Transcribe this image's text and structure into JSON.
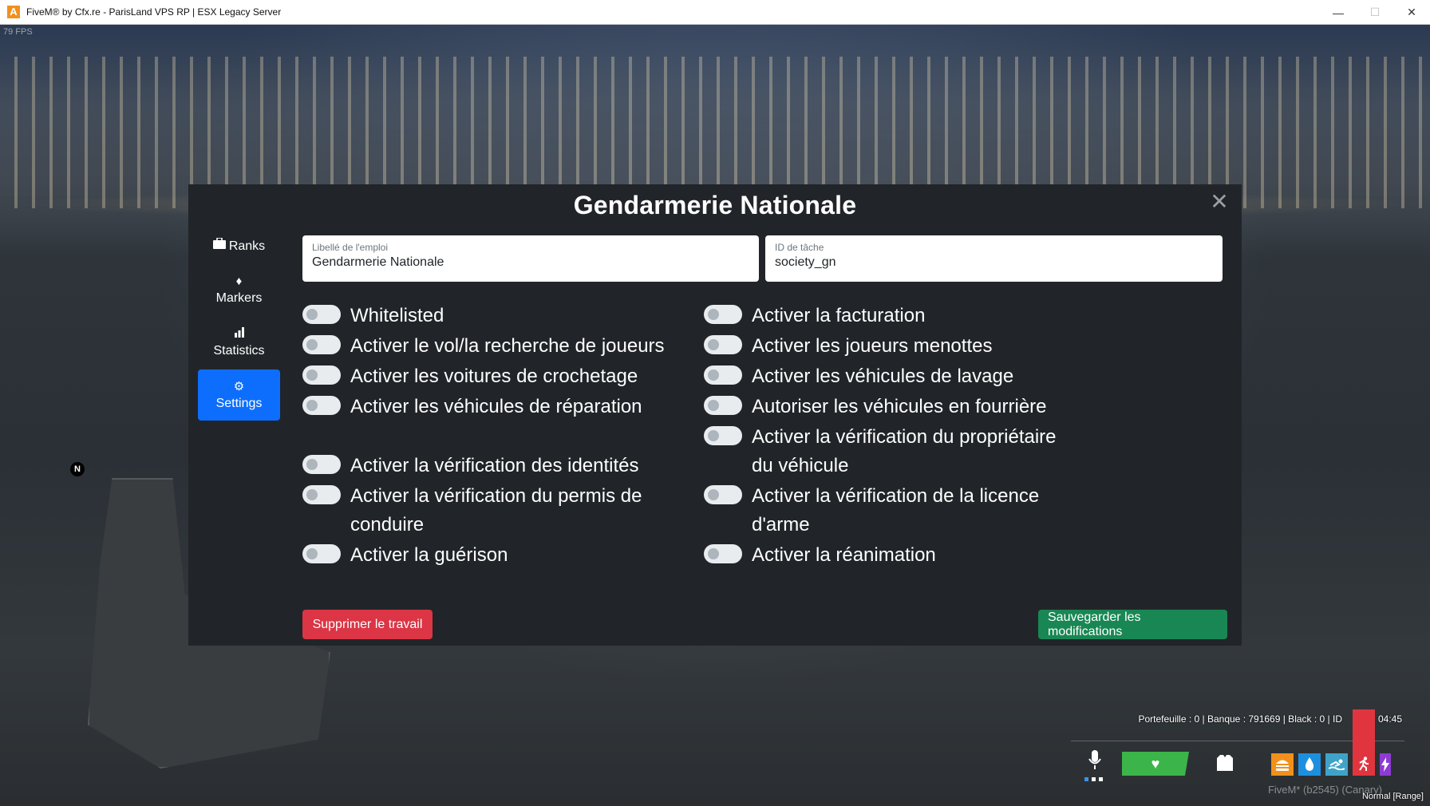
{
  "window": {
    "title": "FiveM® by Cfx.re - ParisLand VPS RP | ESX Legacy Server",
    "icon_letter": "A",
    "controls": {
      "minimize": "—",
      "restore": "☐",
      "close": "✕"
    }
  },
  "overlay": {
    "fps": "79 FPS"
  },
  "modal": {
    "title": "Gendarmerie Nationale",
    "close_symbol": "✕",
    "nav": [
      {
        "label": "Ranks",
        "icon": "briefcase-icon",
        "glyph": "💼"
      },
      {
        "label": "Markers",
        "icon": "map-marker-icon",
        "glyph": "♦"
      },
      {
        "label": "Statistics",
        "icon": "bar-chart-icon",
        "glyph": "▟"
      },
      {
        "label": "Settings",
        "icon": "gear-icon",
        "glyph": "⚙",
        "active": true
      }
    ],
    "fields": {
      "job_label": {
        "label": "Libellé de l'emploi",
        "value": "Gendarmerie Nationale"
      },
      "job_id": {
        "label": "ID de tâche",
        "value": "society_gn"
      }
    },
    "toggles_left": [
      {
        "label": "Whitelisted",
        "checked": false
      },
      {
        "label": "Activer le vol/la recherche de joueurs",
        "checked": false
      },
      {
        "label": "Activer les voitures de crochetage",
        "checked": false
      },
      {
        "label": "Activer les véhicules de réparation",
        "checked": false
      },
      {
        "label": "Activer la vérification des identités",
        "checked": false
      },
      {
        "label": "Activer la vérification du permis de conduire",
        "checked": false
      },
      {
        "label": "Activer la guérison",
        "checked": false
      }
    ],
    "toggles_right": [
      {
        "label": "Activer la facturation",
        "checked": false
      },
      {
        "label": "Activer les joueurs menottes",
        "checked": false
      },
      {
        "label": "Activer les véhicules de lavage",
        "checked": false
      },
      {
        "label": "Autoriser les véhicules en fourrière",
        "checked": false
      },
      {
        "label": "Activer la vérification du propriétaire du véhicule",
        "checked": false
      },
      {
        "label": "Activer la vérification de la licence d'arme",
        "checked": false
      },
      {
        "label": "Activer la réanimation",
        "checked": false
      }
    ],
    "buttons": {
      "delete": "Supprimer le travail",
      "save": "Sauvegarder les modifications"
    }
  },
  "hud": {
    "money": "Portefeuille : 0 | Banque : 791669 | Black : 0 | ID",
    "time": "04:45",
    "footer": "FiveM* (b2545) (Canary)",
    "mode": "Normal [Range]",
    "minimap_north": "N",
    "colors": {
      "health": "#3bb54a",
      "hunger": "#f2901c",
      "thirst": "#1d8fe0",
      "oxygen": "#3fa3c8",
      "stamina": "#e0353f",
      "stress": "#8e3bd4"
    }
  }
}
